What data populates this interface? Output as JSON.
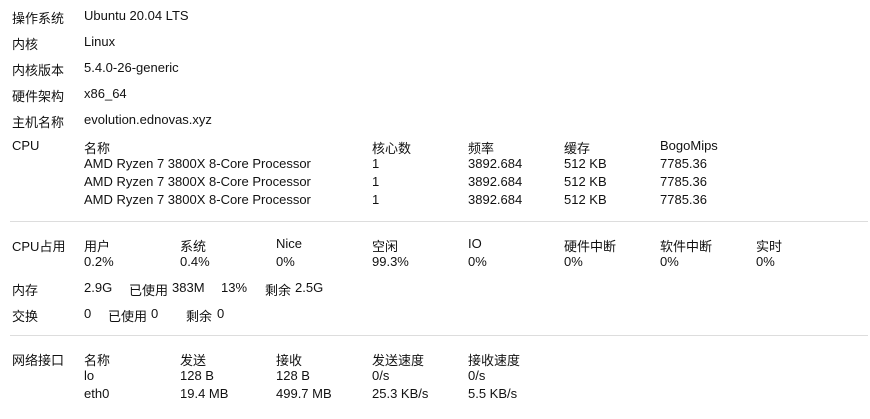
{
  "system": {
    "os_label": "操作系统",
    "os_value": "Ubuntu 20.04 LTS",
    "kernel_label": "内核",
    "kernel_value": "Linux",
    "kernel_version_label": "内核版本",
    "kernel_version_value": "5.4.0-26-generic",
    "arch_label": "硬件架构",
    "arch_value": "x86_64",
    "hostname_label": "主机名称",
    "hostname_value": "evolution.ednovas.xyz"
  },
  "cpu": {
    "label": "CPU",
    "headers": [
      "名称",
      "核心数",
      "频率",
      "缓存",
      "BogoMips"
    ],
    "rows": [
      [
        "AMD Ryzen 7 3800X 8-Core Processor",
        "1",
        "3892.684",
        "512 KB",
        "7785.36"
      ],
      [
        "AMD Ryzen 7 3800X 8-Core Processor",
        "1",
        "3892.684",
        "512 KB",
        "7785.36"
      ],
      [
        "AMD Ryzen 7 3800X 8-Core Processor",
        "1",
        "3892.684",
        "512 KB",
        "7785.36"
      ]
    ]
  },
  "cpu_usage": {
    "label": "CPU占用",
    "headers": [
      "用户",
      "系统",
      "Nice",
      "空闲",
      "IO",
      "硬件中断",
      "软件中断",
      "实时"
    ],
    "values": [
      "0.2%",
      "0.4%",
      "0%",
      "99.3%",
      "0%",
      "0%",
      "0%",
      "0%"
    ]
  },
  "memory": {
    "label": "内存",
    "total": "2.9G",
    "used_label": "已使用",
    "used": "383M",
    "percent": "13%",
    "free_label": "剩余",
    "free": "2.5G"
  },
  "swap": {
    "label": "交换",
    "total": "0",
    "used_label": "已使用",
    "used": "0",
    "free_label": "剩余",
    "free": "0"
  },
  "network": {
    "label": "网络接口",
    "headers": [
      "名称",
      "发送",
      "接收",
      "发送速度",
      "接收速度"
    ],
    "rows": [
      [
        "lo",
        "128 B",
        "128 B",
        "0/s",
        "0/s"
      ],
      [
        "eth0",
        "19.4 MB",
        "499.7 MB",
        "25.3 KB/s",
        "5.5 KB/s"
      ]
    ]
  }
}
